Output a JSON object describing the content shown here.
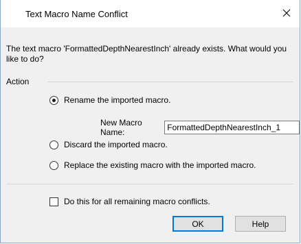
{
  "dialog": {
    "title": "Text Macro Name Conflict",
    "message": "The text macro 'FormattedDepthNearestInch' already exists. What would you like to do?",
    "action_group_label": "Action",
    "options": [
      {
        "label": "Rename the imported macro.",
        "selected": true
      },
      {
        "label": "Discard the imported macro.",
        "selected": false
      },
      {
        "label": "Replace the existing macro with the imported macro.",
        "selected": false
      }
    ],
    "new_name": {
      "label": "New Macro Name:",
      "value": "FormattedDepthNearestInch_1"
    },
    "apply_all": {
      "label": "Do this for all remaining macro conflicts.",
      "checked": false
    },
    "buttons": {
      "ok": "OK",
      "help": "Help"
    },
    "icons": {
      "close": "close-icon"
    },
    "colors": {
      "focus_border": "#0078d7",
      "background": "#f0f0f0"
    }
  }
}
